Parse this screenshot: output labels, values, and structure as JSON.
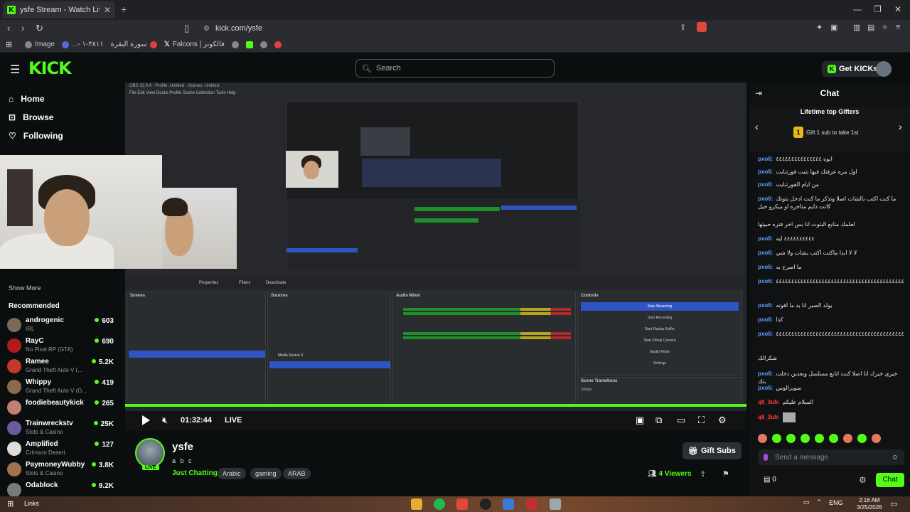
{
  "browser": {
    "tab_title": "ysfe Stream - Watch Live on Kick",
    "tab_close": "✕",
    "new_tab": "+",
    "url": "kick.com/ysfe",
    "bookmarks": [
      {
        "label": "Image",
        "color": "#888888"
      },
      {
        "label": "...- ٣٨١١-١",
        "color": "#5a67d8"
      },
      {
        "label": "سورة البقرة",
        "color": "#e53e3e"
      },
      {
        "label": "Falcons | فالكونز",
        "color": "#ffffff"
      },
      {
        "label": "",
        "color": "#888888"
      },
      {
        "label": "",
        "color": "#53fc18"
      },
      {
        "label": "",
        "color": "#888888"
      },
      {
        "label": "",
        "color": "#e53e3e"
      }
    ]
  },
  "header": {
    "logo": "KICK",
    "search_placeholder": "Search",
    "get_kicks": "Get KICKs"
  },
  "sidebar": {
    "nav": [
      {
        "label": "Home",
        "icon": "home-icon"
      },
      {
        "label": "Browse",
        "icon": "browse-icon"
      },
      {
        "label": "Following",
        "icon": "heart-icon"
      }
    ],
    "show_more": "Show More",
    "recommended_title": "Recommended",
    "recommended": [
      {
        "name": "androgenic",
        "category": "IRL",
        "viewers": "603",
        "color": "#7a6a5a"
      },
      {
        "name": "RayC",
        "category": "No Pixel RP (GTA)",
        "viewers": "690",
        "color": "#b31b1b"
      },
      {
        "name": "Ramee",
        "category": "Grand Theft Auto V (...",
        "viewers": "5.2K",
        "color": "#c0392b"
      },
      {
        "name": "Whippy",
        "category": "Grand Theft Auto V (G...",
        "viewers": "419",
        "color": "#8a6a4a"
      },
      {
        "name": "foodiebeautykick",
        "category": "",
        "viewers": "265",
        "color": "#c08070"
      },
      {
        "name": "Trainwreckstv",
        "category": "Slots & Casino",
        "viewers": "25K",
        "color": "#6a5a9a"
      },
      {
        "name": "Amplified",
        "category": "Crimson Desert",
        "viewers": "127",
        "color": "#dddddd"
      },
      {
        "name": "PaymoneyWubby",
        "category": "Slots & Casino",
        "viewers": "3.8K",
        "color": "#a07050"
      },
      {
        "name": "Odablock",
        "category": "",
        "viewers": "9.2K",
        "color": "#7a7a7a"
      }
    ]
  },
  "player": {
    "time": "01:32:44",
    "live": "LIVE",
    "obs_title": "OBS 32.0.4 - Profile: Untitled - Scenes: Untitled",
    "obs_menu": "File   Edit   View   Docks   Profile   Scene Collection   Tools   Help",
    "docks": {
      "scenes": "Scenes",
      "sources": "Sources",
      "mixer": "Audio Mixer",
      "controls": "Controls",
      "transitions": "Scene Transitions"
    },
    "toolbar": {
      "properties": "Properties",
      "filters": "Filters",
      "deactivate": "Deactivate"
    },
    "controls_buttons": [
      "Stop Streaming",
      "Start Recording",
      "Start Replay Buffer",
      "Start Virtual Camera",
      "Studio Mode",
      "Settings"
    ],
    "transition_value": "Stinger",
    "media_source": "Media Source 3"
  },
  "stream": {
    "channel": "ysfe",
    "title": "a b c",
    "category": "Just Chatting",
    "tags": [
      "Arabic",
      "gaming",
      "ARAB"
    ],
    "gift_subs": "Gift Subs",
    "viewer_count": "4",
    "viewer_label": "Viewers",
    "live_badge": "LIVE"
  },
  "chat": {
    "title": "Chat",
    "lifetime_title": "Lifetime top Gifters",
    "gift_rank": "1",
    "gift_prompt": "Gift 1 sub to take 1st",
    "messages": [
      {
        "user": "pxo6:",
        "text": "ايوه ٤٤٤٤٤٤٤٤٤٤٤٤٤٤٤",
        "red": false
      },
      {
        "user": "pxo6:",
        "text": "اول مره عرفتك فيها بثيت فورتنايت",
        "red": false
      },
      {
        "user": "pxo6:",
        "text": "من ايام الفورتنايت",
        "red": false
      },
      {
        "user": "pxo6:",
        "text": "ما كنت اكتب بالشات اصلا وتذكر ما كنت ادخل بثوتك كانت دايم متاخره او ميكرو حيل",
        "red": false
      },
      {
        "user": "",
        "text": "لعلمك متابع البثوت انا بس اخر فتره حبيتها",
        "red": false
      },
      {
        "user": "pxo6:",
        "text": "٤٤٤٤٤٤٤٤٤٤ ليه",
        "red": false
      },
      {
        "user": "pxo6:",
        "text": "لا لا ابدا ماكنت اكتب بشات ولا شي",
        "red": false
      },
      {
        "user": "pxo6:",
        "text": "ما اصرح به",
        "red": false
      },
      {
        "user": "pxo6:",
        "text": "٤٤٤٤٤٤٤٤٤٤٤٤٤٤٤٤٤٤٤٤٤٤٤٤٤٤٤٤٤٤٤٤٤٤٤٤٤٤٤٤٤٤٤٤٤",
        "red": false
      },
      {
        "user": "pxo6:",
        "text": "يولد الصبر انا بد ما افوته",
        "red": false
      },
      {
        "user": "pxo6:",
        "text": "كذا",
        "red": false
      },
      {
        "user": "pxo6:",
        "text": "٤٤٤٤٤٤٤٤٤٤٤٤٤٤٤٤٤٤٤٤٤٤٤٤٤٤٤٤٤٤٤٤٤٤٤٤٤٤٤٤٤٤٤٤٤",
        "red": false
      },
      {
        "user": "",
        "text": "شكرالك",
        "red": false
      },
      {
        "user": "pxo6:",
        "text": "خيري خيرك انا اصلا كنت اتابع مسلسل وبعدين دخلت بثك",
        "red": false
      },
      {
        "user": "pxo6:",
        "text": "سويرالوس",
        "red": false
      },
      {
        "user": "q8_3ub:",
        "text": "السلام عليكم",
        "red": true
      },
      {
        "user": "q8_3ub:",
        "text": "",
        "red": true
      }
    ],
    "input_placeholder": "Send a message",
    "kicks_balance": "0",
    "chat_button": "Chat"
  },
  "taskbar": {
    "label": "Links",
    "lang": "ENG",
    "time": "2:16 AM",
    "date": "3/25/2026"
  }
}
